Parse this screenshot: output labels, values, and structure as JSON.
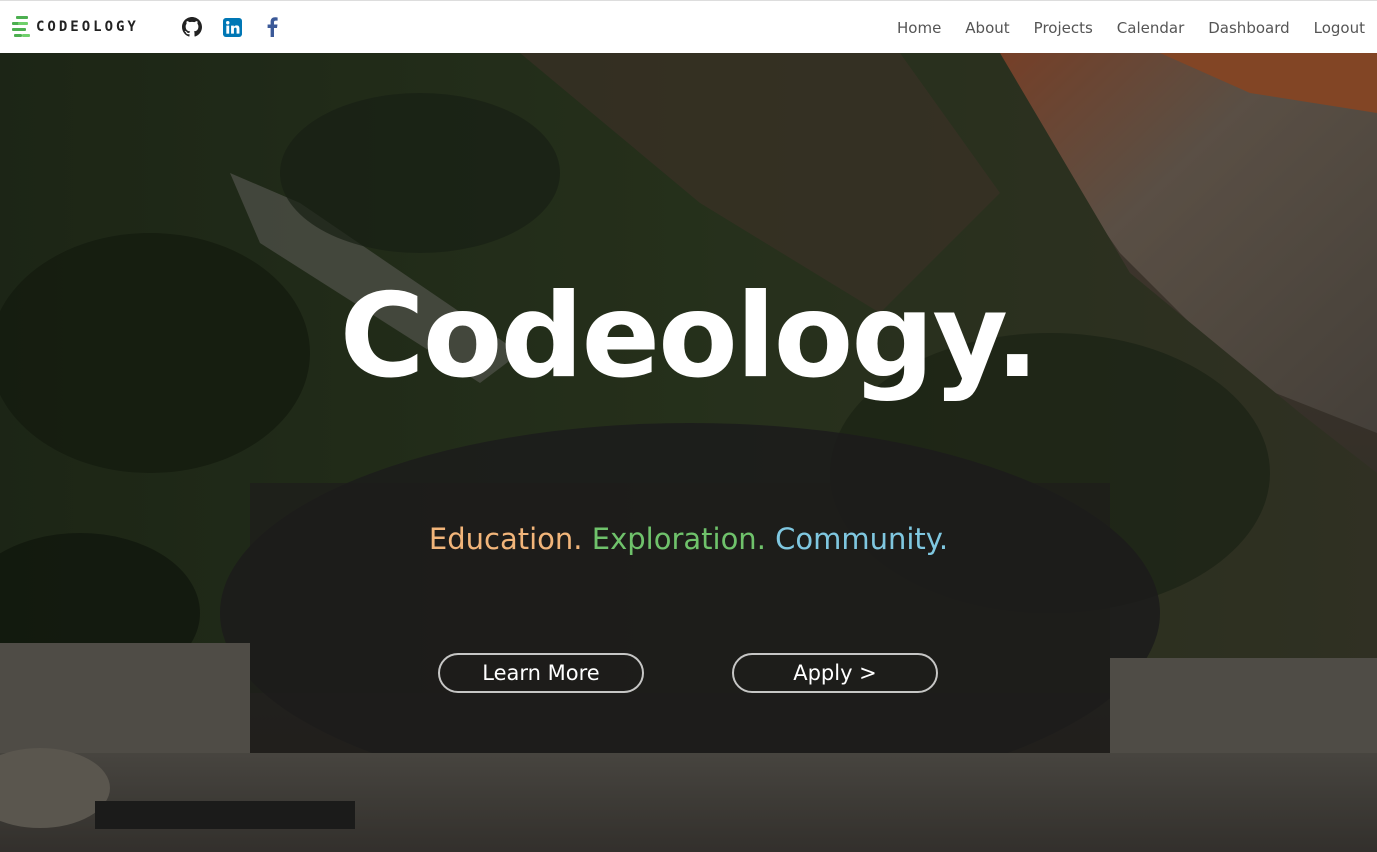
{
  "brand": {
    "name": "CODEOLOGY",
    "accent": "#4caf50"
  },
  "social": [
    {
      "name": "github-icon",
      "color": "#222222"
    },
    {
      "name": "linkedin-icon",
      "color": "#0077b5"
    },
    {
      "name": "facebook-icon",
      "color": "#3b5998"
    }
  ],
  "nav": {
    "home": "Home",
    "about": "About",
    "projects": "Projects",
    "calendar": "Calendar",
    "dashboard": "Dashboard",
    "logout": "Logout"
  },
  "hero": {
    "title": "Codeology.",
    "tagline": {
      "education": "Education.",
      "exploration": "Exploration.",
      "community": "Community."
    },
    "colors": {
      "education": "#f2b57a",
      "exploration": "#6fc26b",
      "community": "#7fc7e0"
    },
    "learn_more": "Learn More",
    "apply": "Apply >"
  }
}
